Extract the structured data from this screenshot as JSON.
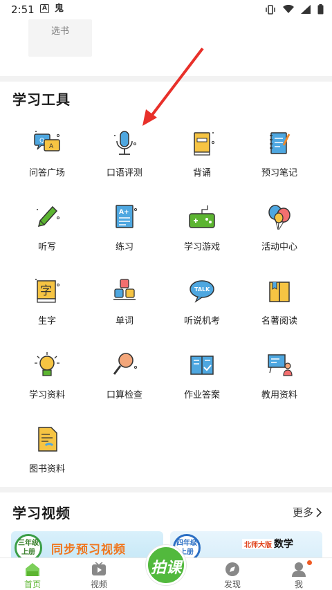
{
  "status_bar": {
    "time": "2:51",
    "left_icons": [
      "A",
      "鬼"
    ]
  },
  "top": {
    "select_book_label": "选书"
  },
  "tools": {
    "title": "学习工具",
    "items": [
      {
        "label": "问答广场",
        "icon": "qa-plaza-icon"
      },
      {
        "label": "口语评测",
        "icon": "microphone-icon"
      },
      {
        "label": "背诵",
        "icon": "book-recite-icon"
      },
      {
        "label": "预习笔记",
        "icon": "notebook-icon"
      },
      {
        "label": "听写",
        "icon": "pencil-icon"
      },
      {
        "label": "练习",
        "icon": "exercise-sheet-icon"
      },
      {
        "label": "学习游戏",
        "icon": "gamepad-icon"
      },
      {
        "label": "活动中心",
        "icon": "balloons-icon"
      },
      {
        "label": "生字",
        "icon": "new-character-icon"
      },
      {
        "label": "单词",
        "icon": "word-blocks-icon"
      },
      {
        "label": "听说机考",
        "icon": "talk-bubble-icon"
      },
      {
        "label": "名著阅读",
        "icon": "classic-book-icon"
      },
      {
        "label": "学习资料",
        "icon": "lightbulb-icon"
      },
      {
        "label": "口算检查",
        "icon": "magnifier-icon"
      },
      {
        "label": "作业答案",
        "icon": "answer-book-icon"
      },
      {
        "label": "教用资料",
        "icon": "teacher-board-icon"
      },
      {
        "label": "图书资料",
        "icon": "document-icon"
      }
    ]
  },
  "videos": {
    "title": "学习视频",
    "more_label": "更多",
    "card1": {
      "grade": "三年级",
      "term": "上册",
      "title": "同步预习视频"
    },
    "card2": {
      "grade": "四年级",
      "term": "上册",
      "publisher": "北师大版",
      "subject": "数学"
    }
  },
  "bottom_nav": {
    "items": [
      {
        "label": "首页",
        "icon": "home-icon"
      },
      {
        "label": "视频",
        "icon": "video-icon"
      },
      {
        "label": "发现",
        "icon": "discover-icon"
      },
      {
        "label": "我",
        "icon": "profile-icon"
      }
    ],
    "center_label": "拍课",
    "accent": "#52b93d"
  },
  "colors": {
    "arrow": "#e8302a",
    "active_tab": "#5cb531"
  }
}
